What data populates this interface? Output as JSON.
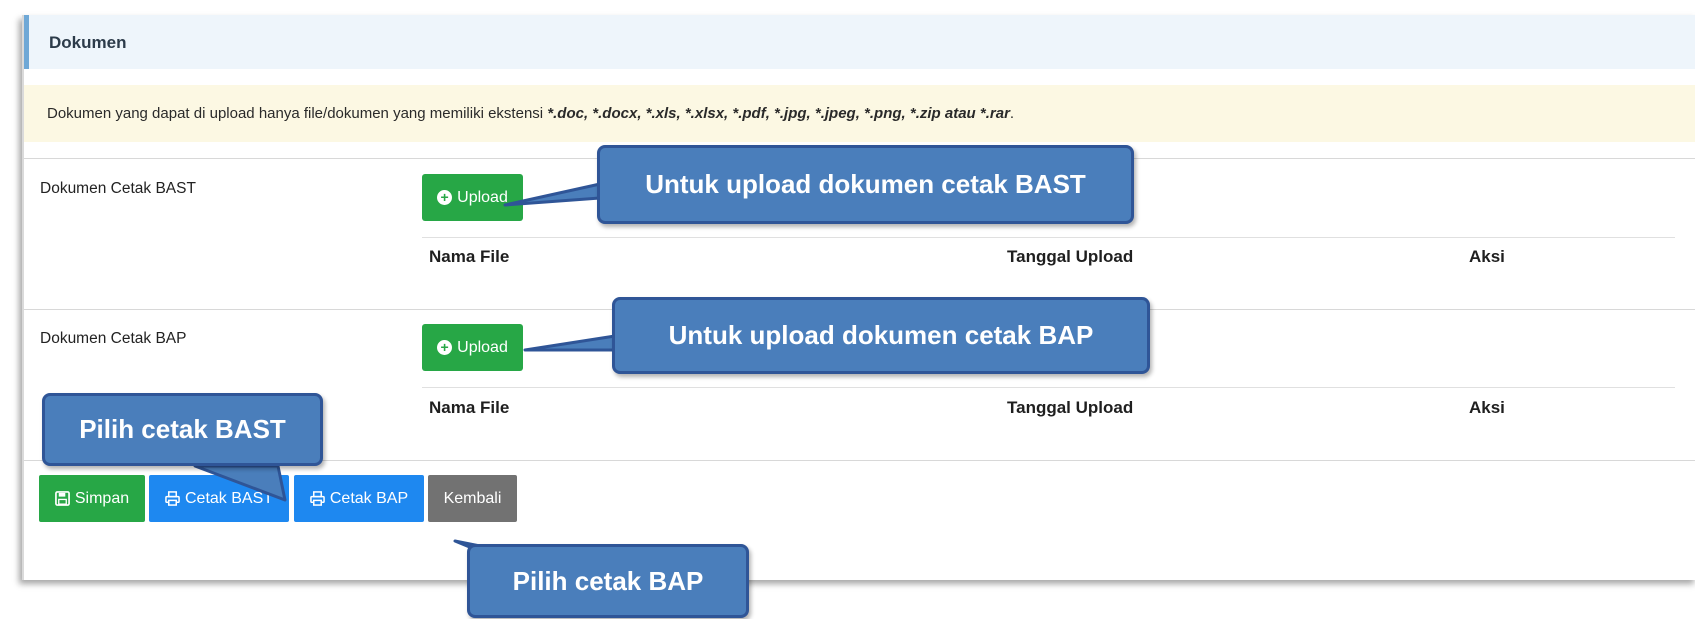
{
  "header": {
    "title": "Dokumen"
  },
  "notice": {
    "prefix": "Dokumen yang dapat di upload hanya file/dokumen yang memiliki ekstensi ",
    "extensions": "*.doc, *.docx, *.xls, *.xlsx, *.pdf, *.jpg, *.jpeg, *.png, *.zip atau *.rar",
    "suffix": "."
  },
  "sections": [
    {
      "label": "Dokumen Cetak BAST",
      "upload_label": "Upload",
      "columns": [
        "Nama File",
        "Tanggal Upload",
        "Aksi"
      ]
    },
    {
      "label": "Dokumen Cetak BAP",
      "upload_label": "Upload",
      "columns": [
        "Nama File",
        "Tanggal Upload",
        "Aksi"
      ]
    }
  ],
  "footer": {
    "simpan": "Simpan",
    "cetak_bast": "Cetak BAST",
    "cetak_bap": "Cetak BAP",
    "kembali": "Kembali"
  },
  "callouts": {
    "upload_bast": "Untuk upload dokumen cetak BAST",
    "upload_bap": "Untuk upload dokumen cetak BAP",
    "pilih_bast": "Pilih cetak BAST",
    "pilih_bap": "Pilih cetak BAP"
  },
  "colors": {
    "success": "#27a746",
    "primary": "#1e88f0",
    "secondary": "#727272",
    "callout_fill": "#4a7ebb",
    "callout_border": "#2f5597",
    "notice_bg": "#fcf8e3",
    "header_bg": "#eef5fb"
  }
}
